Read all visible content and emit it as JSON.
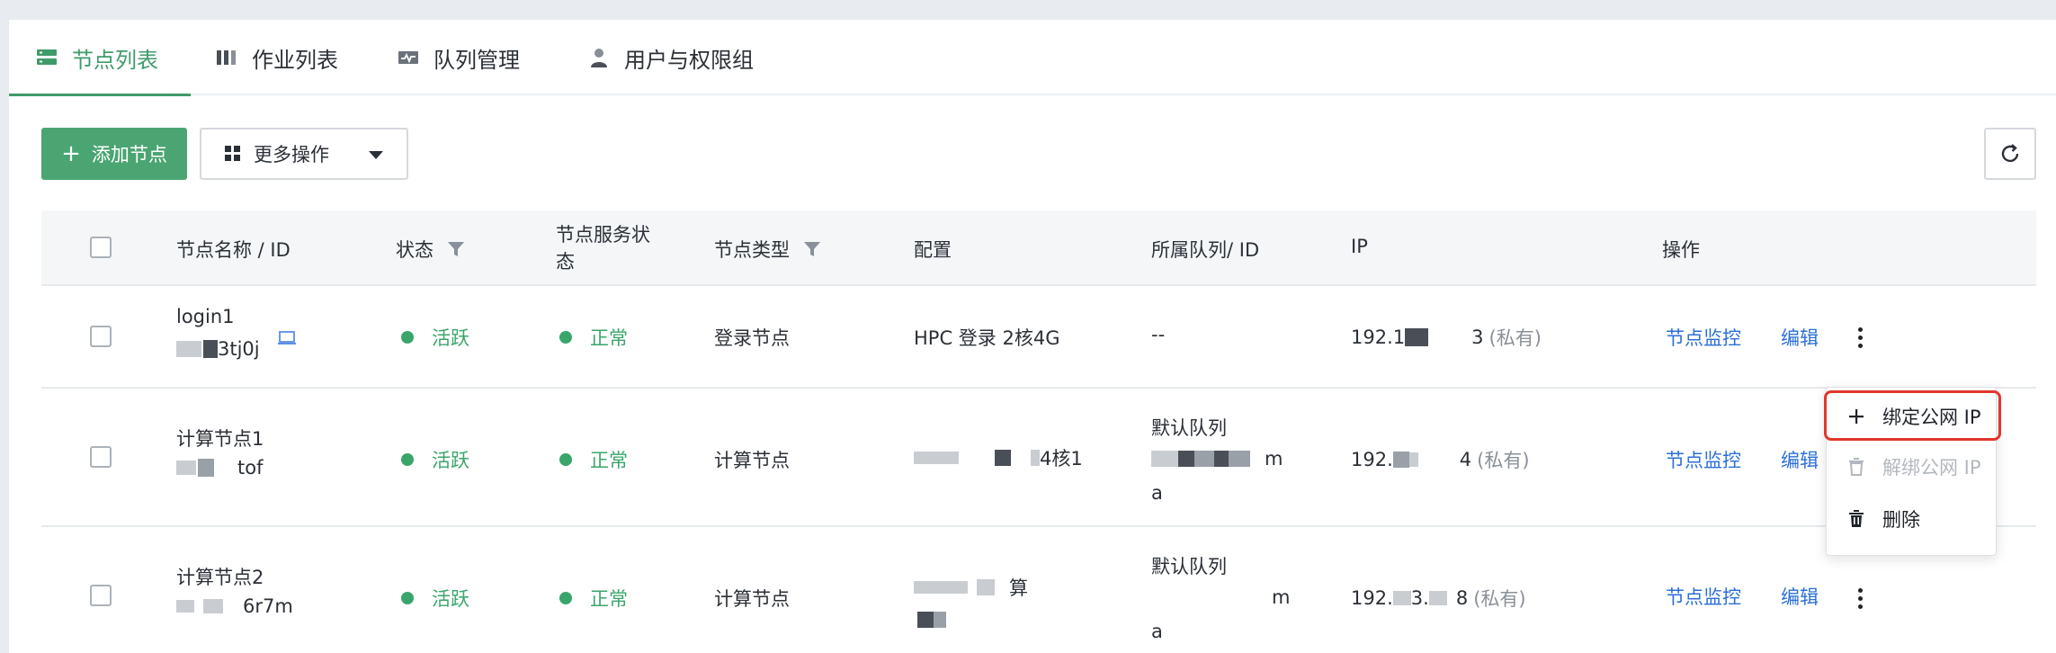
{
  "tabs": [
    {
      "label": "节点列表",
      "icon": "server-icon",
      "active": true
    },
    {
      "label": "作业列表",
      "icon": "jobs-icon",
      "active": false
    },
    {
      "label": "队列管理",
      "icon": "queue-icon",
      "active": false
    },
    {
      "label": "用户与权限组",
      "icon": "user-icon",
      "active": false
    }
  ],
  "toolbar": {
    "add_label": "添加节点",
    "more_label": "更多操作"
  },
  "table": {
    "headers": {
      "name": "节点名称 / ID",
      "state": "状态",
      "service_line1": "节点服务状",
      "service_line2": "态",
      "type": "节点类型",
      "config": "配置",
      "queue": "所属队列/ ID",
      "ip": "IP",
      "ops": "操作"
    },
    "rows": [
      {
        "name": "login1",
        "id_suffix": "3tj0j",
        "state": "活跃",
        "service": "正常",
        "type": "登录节点",
        "config": "HPC 登录 2核4G",
        "queue": "--",
        "ip_prefix": "192.1",
        "ip_suffix": "3",
        "ip_note": "(私有)",
        "op_monitor": "节点监控",
        "op_edit": "编辑"
      },
      {
        "name": "计算节点1",
        "id_suffix": "tof",
        "state": "活跃",
        "service": "正常",
        "type": "计算节点",
        "config_suffix": "4核1",
        "queue_name": "默认队列",
        "queue_id_tail": "m",
        "queue_id_line2": "a",
        "ip_prefix": "192.",
        "ip_suffix": "4",
        "ip_note": "(私有)",
        "op_monitor": "节点监控",
        "op_edit": "编辑"
      },
      {
        "name": "计算节点2",
        "id_suffix": "6r7m",
        "state": "活跃",
        "service": "正常",
        "type": "计算节点",
        "config_suffix": "算",
        "queue_name": "默认队列",
        "queue_id_tail": "m",
        "queue_id_line2": "a",
        "ip_prefix": "192.",
        "ip_mid": "3.",
        "ip_suffix": "8",
        "ip_note": "(私有)",
        "op_monitor": "节点监控",
        "op_edit": "编辑"
      }
    ]
  },
  "menu": {
    "items": [
      {
        "label": "绑定公网 IP",
        "icon": "plus-icon",
        "disabled": false
      },
      {
        "label": "解绑公网 IP",
        "icon": "trash-icon",
        "disabled": true
      },
      {
        "label": "删除",
        "icon": "trash-icon",
        "disabled": false
      }
    ]
  },
  "colors": {
    "accent": "#3f9b6a",
    "primary_button": "#4aa572",
    "link": "#2c6fd6",
    "status_green": "#3aa56b",
    "highlight": "#e0362c"
  }
}
